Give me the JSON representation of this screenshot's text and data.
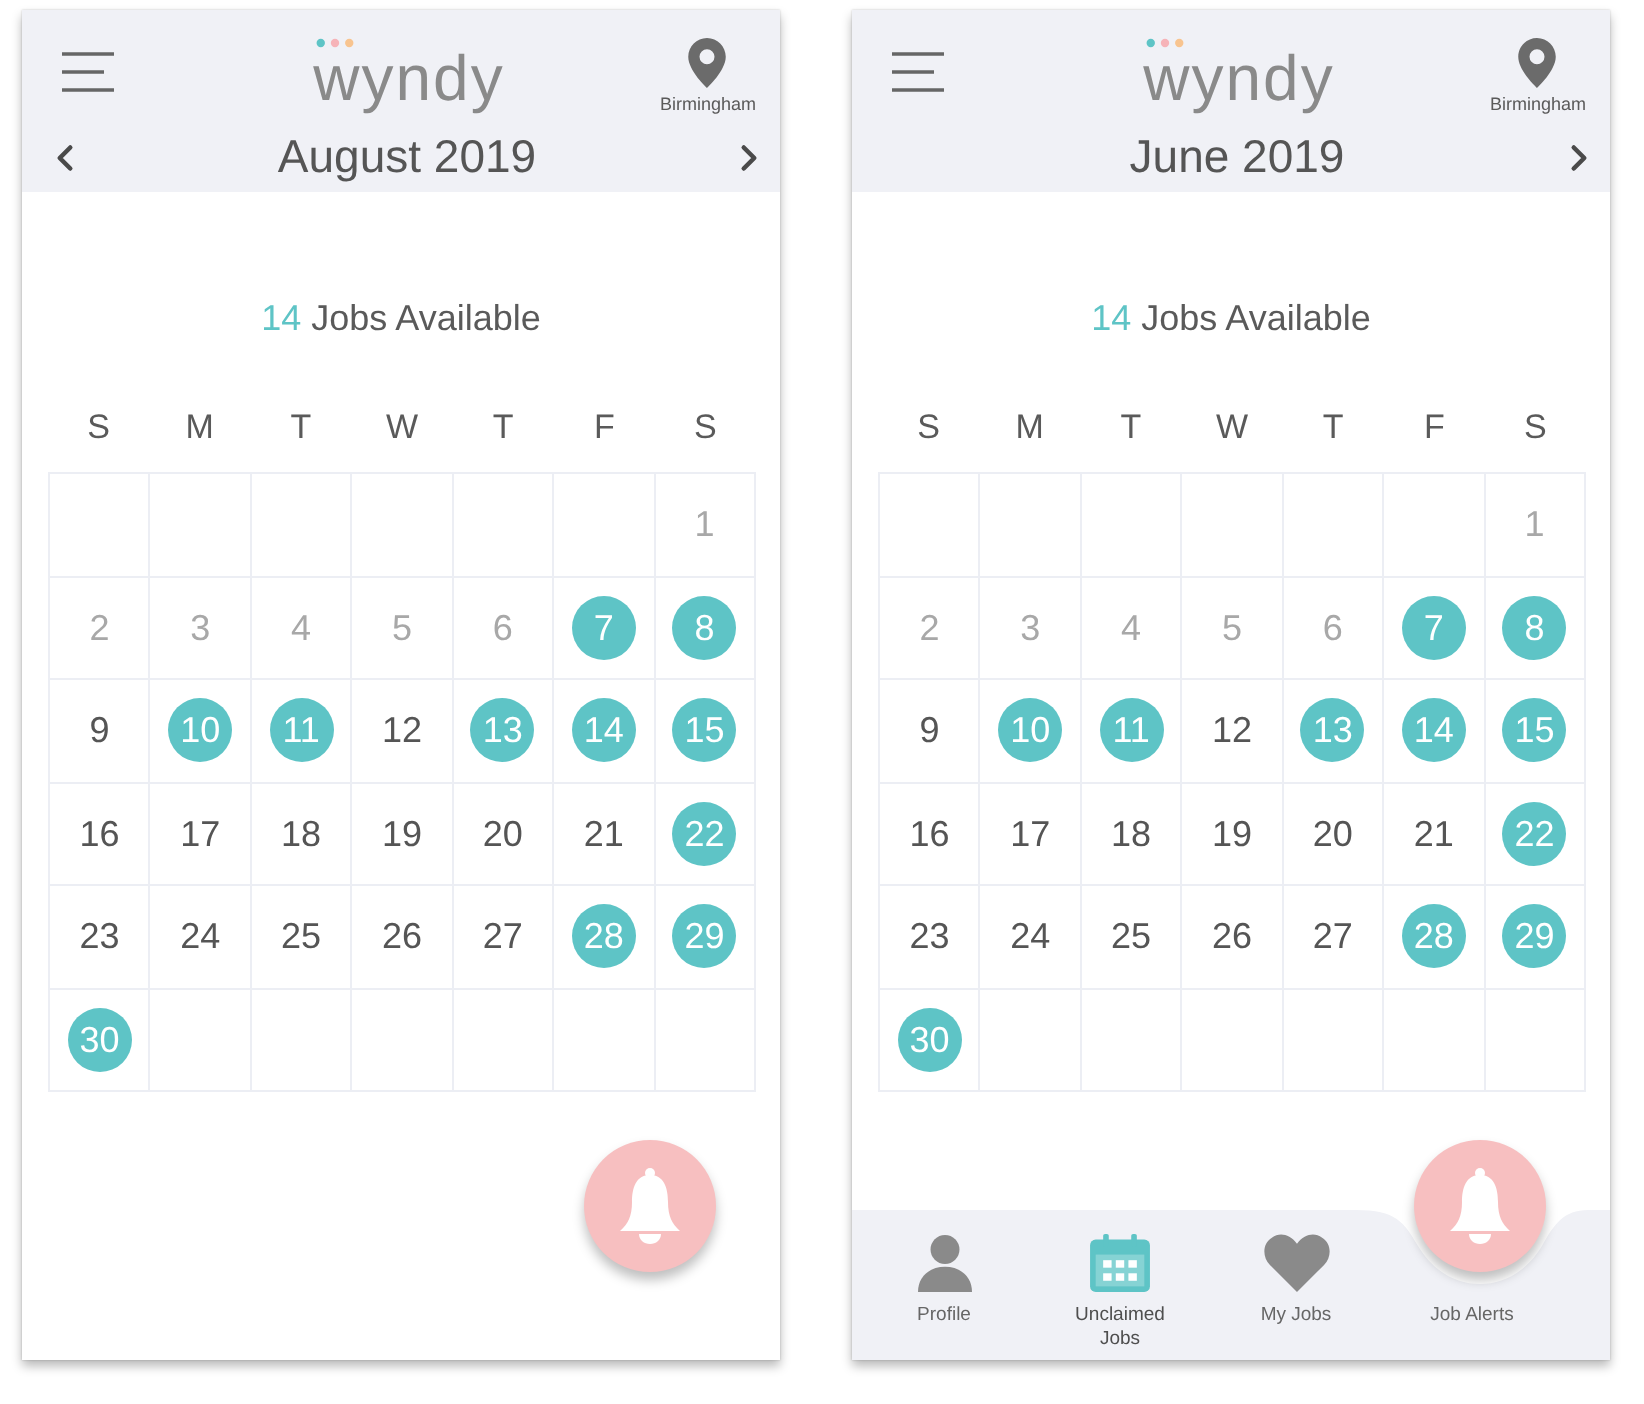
{
  "screens": [
    {
      "logo": "wyndy",
      "location": "Birmingham",
      "month": "August 2019",
      "prev_month_button": true,
      "jobs_count": "14",
      "jobs_label": "Jobs Available",
      "weekdays": [
        "S",
        "M",
        "T",
        "W",
        "T",
        "F",
        "S"
      ],
      "weeks": [
        [
          {
            "kind": "blank"
          },
          {
            "kind": "blank"
          },
          {
            "kind": "blank"
          },
          {
            "kind": "blank"
          },
          {
            "kind": "blank"
          },
          {
            "kind": "blank"
          },
          {
            "day": "1",
            "kind": "past"
          }
        ],
        [
          {
            "day": "2",
            "kind": "past"
          },
          {
            "day": "3",
            "kind": "past"
          },
          {
            "day": "4",
            "kind": "past"
          },
          {
            "day": "5",
            "kind": "past"
          },
          {
            "day": "6",
            "kind": "past"
          },
          {
            "day": "7",
            "kind": "jobs"
          },
          {
            "day": "8",
            "kind": "jobs"
          }
        ],
        [
          {
            "day": "9",
            "kind": "plain"
          },
          {
            "day": "10",
            "kind": "jobs"
          },
          {
            "day": "11",
            "kind": "jobs"
          },
          {
            "day": "12",
            "kind": "plain"
          },
          {
            "day": "13",
            "kind": "jobs"
          },
          {
            "day": "14",
            "kind": "jobs"
          },
          {
            "day": "15",
            "kind": "jobs"
          }
        ],
        [
          {
            "day": "16",
            "kind": "plain"
          },
          {
            "day": "17",
            "kind": "plain"
          },
          {
            "day": "18",
            "kind": "plain"
          },
          {
            "day": "19",
            "kind": "plain"
          },
          {
            "day": "20",
            "kind": "plain"
          },
          {
            "day": "21",
            "kind": "plain"
          },
          {
            "day": "22",
            "kind": "jobs"
          }
        ],
        [
          {
            "day": "23",
            "kind": "plain"
          },
          {
            "day": "24",
            "kind": "plain"
          },
          {
            "day": "25",
            "kind": "plain"
          },
          {
            "day": "26",
            "kind": "plain"
          },
          {
            "day": "27",
            "kind": "plain"
          },
          {
            "day": "28",
            "kind": "jobs"
          },
          {
            "day": "29",
            "kind": "jobs"
          }
        ],
        [
          {
            "day": "30",
            "kind": "jobs"
          },
          {
            "kind": "blank"
          },
          {
            "kind": "blank"
          },
          {
            "kind": "blank"
          },
          {
            "kind": "blank"
          },
          {
            "kind": "blank"
          },
          {
            "kind": "blank"
          }
        ]
      ]
    },
    {
      "logo": "wyndy",
      "location": "Birmingham",
      "month": "June 2019",
      "prev_month_button": false,
      "jobs_count": "14",
      "jobs_label": "Jobs Available",
      "weekdays": [
        "S",
        "M",
        "T",
        "W",
        "T",
        "F",
        "S"
      ],
      "weeks": [
        [
          {
            "kind": "blank"
          },
          {
            "kind": "blank"
          },
          {
            "kind": "blank"
          },
          {
            "kind": "blank"
          },
          {
            "kind": "blank"
          },
          {
            "kind": "blank"
          },
          {
            "day": "1",
            "kind": "past"
          }
        ],
        [
          {
            "day": "2",
            "kind": "past"
          },
          {
            "day": "3",
            "kind": "past"
          },
          {
            "day": "4",
            "kind": "past"
          },
          {
            "day": "5",
            "kind": "past"
          },
          {
            "day": "6",
            "kind": "past"
          },
          {
            "day": "7",
            "kind": "jobs"
          },
          {
            "day": "8",
            "kind": "jobs"
          }
        ],
        [
          {
            "day": "9",
            "kind": "plain"
          },
          {
            "day": "10",
            "kind": "jobs"
          },
          {
            "day": "11",
            "kind": "jobs"
          },
          {
            "day": "12",
            "kind": "plain"
          },
          {
            "day": "13",
            "kind": "jobs"
          },
          {
            "day": "14",
            "kind": "jobs"
          },
          {
            "day": "15",
            "kind": "jobs"
          }
        ],
        [
          {
            "day": "16",
            "kind": "plain"
          },
          {
            "day": "17",
            "kind": "plain"
          },
          {
            "day": "18",
            "kind": "plain"
          },
          {
            "day": "19",
            "kind": "plain"
          },
          {
            "day": "20",
            "kind": "plain"
          },
          {
            "day": "21",
            "kind": "plain"
          },
          {
            "day": "22",
            "kind": "jobs"
          }
        ],
        [
          {
            "day": "23",
            "kind": "plain"
          },
          {
            "day": "24",
            "kind": "plain"
          },
          {
            "day": "25",
            "kind": "plain"
          },
          {
            "day": "26",
            "kind": "plain"
          },
          {
            "day": "27",
            "kind": "plain"
          },
          {
            "day": "28",
            "kind": "jobs"
          },
          {
            "day": "29",
            "kind": "jobs"
          }
        ],
        [
          {
            "day": "30",
            "kind": "jobs"
          },
          {
            "kind": "blank"
          },
          {
            "kind": "blank"
          },
          {
            "kind": "blank"
          },
          {
            "kind": "blank"
          },
          {
            "kind": "blank"
          },
          {
            "kind": "blank"
          }
        ]
      ],
      "tabs": [
        {
          "label": "Profile",
          "kind": "profile",
          "selected": false
        },
        {
          "label": "Unclaimed Jobs",
          "kind": "calendar",
          "selected": true
        },
        {
          "label": "My Jobs",
          "kind": "heart",
          "selected": false
        },
        {
          "label": "Job Alerts",
          "kind": "alerts",
          "selected": false
        }
      ]
    }
  ]
}
